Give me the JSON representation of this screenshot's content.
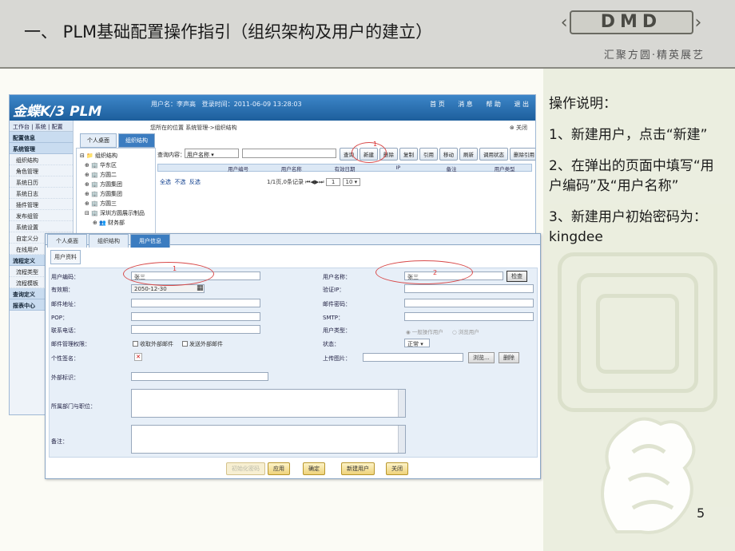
{
  "slide": {
    "title": "一、 PLM基础配置操作指引（组织架构及用户的建立）",
    "logo_text": "DMD",
    "slogan": "汇聚方圆·精英展艺",
    "page_number": "5",
    "notes": [
      "操作说明：",
      "1、新建用户，点击“新建”",
      "2、在弹出的页面中填写“用户编码”及“用户名称”",
      "3、新建用户初始密码为：kingdee"
    ]
  },
  "app": {
    "logo": "金蝶K/3 PLM",
    "user_label": "用户名：李声高",
    "login_time": "登录时间：2011-06-09 13:28:03",
    "top_menu": [
      "首 页",
      "消 息",
      "帮 助",
      "退 出"
    ],
    "top_nav": "工作台 | 系统 | 配置",
    "crumb": "您所在的位置 系统管理->组织结构",
    "close_label": "关闭",
    "tabs": [
      "个人桌面",
      "组织结构"
    ],
    "left_menu": [
      "配置信息",
      "系统管理",
      "组织结构",
      "角色管理",
      "系统日历",
      "系统日志",
      "插件管理",
      "发布组管",
      "系统设置",
      "自定义分",
      "在线用户",
      "流程定义",
      "流程类型",
      "流程模板",
      "查询定义",
      "报表中心"
    ],
    "tree": [
      "组织结构",
      "华东区",
      "方圆二",
      "方圆集团",
      "方圆集团",
      "方圆三",
      "深圳方圆展示制品",
      "财务部"
    ],
    "search_label": "查询内容：",
    "search_field": "用户名称",
    "toolbar": [
      "查询",
      "新建",
      "删除",
      "复制",
      "引用",
      "移动",
      "刷新",
      "调用状态",
      "删除引用"
    ],
    "grid_headers": [
      "",
      "用户编号",
      "用户名称",
      "有效日期",
      "IP",
      "备注",
      "用户类型"
    ],
    "select_all": "全选",
    "select_none": "不选",
    "invert": "反选",
    "pager_info": "1/1页,0条记录",
    "page_input": "1",
    "page_size": "10"
  },
  "popup": {
    "tabs": [
      "个人桌面",
      "组织结构",
      "用户信息"
    ],
    "section": "用户资料",
    "labels": {
      "user_code": "用户编码：",
      "user_name": "用户名称：",
      "expiry": "有效期：",
      "verify_ip": "验证IP：",
      "mail_address": "邮件地址：",
      "mail_password": "邮件密码：",
      "pop": "POP：",
      "smtp": "SMTP：",
      "phone": "联系电话：",
      "user_type": "用户类型：",
      "mail_mgmt": "邮件管理权限：",
      "status": "状态：",
      "signature": "个性签名：",
      "upload": "上传图片：",
      "external": "外部标识：",
      "dept": "所属部门与职位：",
      "remark": "备注："
    },
    "values": {
      "user_code": "张三",
      "user_name": "张三",
      "expiry": "2050-12-30",
      "status": "正常"
    },
    "check_button": "检查",
    "receive_mail": "收取外部邮件",
    "send_mail": "发送外部邮件",
    "user_type_opts": [
      "一般操作用户",
      "浏览用户"
    ],
    "browse": "浏览...",
    "delete": "删除",
    "buttons": [
      "初始化密码",
      "应用",
      "确定",
      "新建用户",
      "关闭"
    ],
    "marks": [
      "1",
      "2"
    ]
  },
  "mark_new": "1"
}
